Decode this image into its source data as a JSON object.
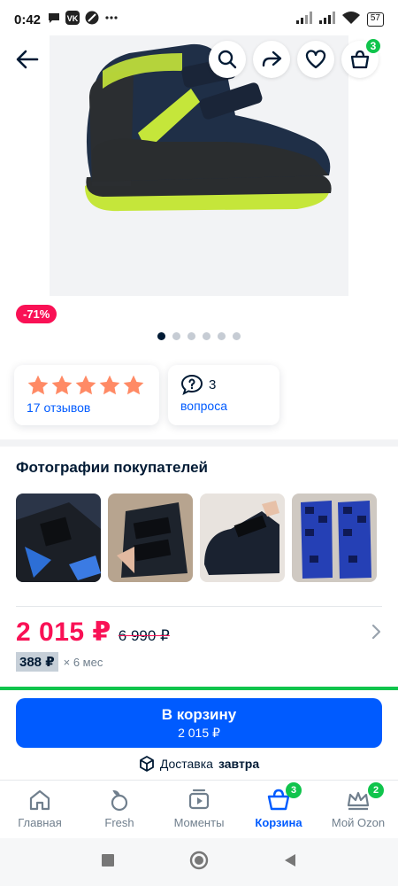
{
  "status_bar": {
    "time": "0:42",
    "battery": "57"
  },
  "product": {
    "discount_badge": "-71%",
    "gallery_count": 6,
    "gallery_active_index": 0
  },
  "header": {
    "cart_count": "3"
  },
  "rating": {
    "stars": 5,
    "reviews_label": "17 отзывов"
  },
  "questions": {
    "count": "3",
    "label": "вопроса"
  },
  "customer_photos": {
    "title": "Фотографии покупателей"
  },
  "price": {
    "current": "2 015 ₽",
    "old": "6 990 ₽",
    "installment_amount": "388 ₽",
    "installment_term": "× 6 мес"
  },
  "buy_button": {
    "label": "В корзину",
    "sub": "2 015 ₽"
  },
  "delivery": {
    "prefix": "Доставка",
    "when": "завтра"
  },
  "tabbar": {
    "items": [
      {
        "label": "Главная",
        "icon": "home-icon"
      },
      {
        "label": "Fresh",
        "icon": "fresh-icon"
      },
      {
        "label": "Моменты",
        "icon": "moments-icon"
      },
      {
        "label": "Корзина",
        "icon": "cart-icon",
        "badge": "3",
        "active": true
      },
      {
        "label": "Мой Ozon",
        "icon": "crown-icon",
        "badge": "2"
      }
    ]
  },
  "colors": {
    "accent": "#005bff",
    "sale": "#f91155",
    "green": "#10c44c",
    "text": "#001a34"
  }
}
